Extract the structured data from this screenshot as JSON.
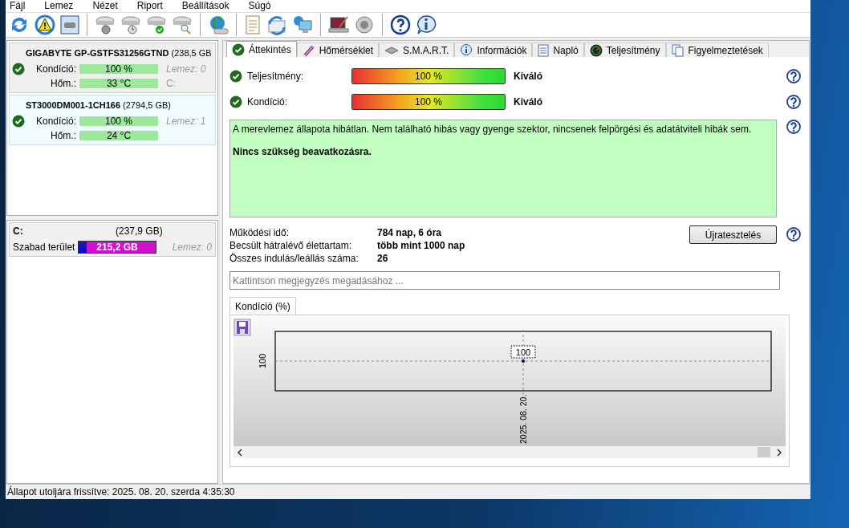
{
  "menu": [
    "Fájl",
    "Lemez",
    "Nézet",
    "Riport",
    "Beállítások",
    "Súgó"
  ],
  "disks": [
    {
      "name": "GIGABYTE GP-GSTFS31256GTND",
      "size": "(238,5 GB",
      "selected": false,
      "healthy": true,
      "rows": [
        {
          "label": "Kondíció:",
          "reading": "100 %",
          "level": 1,
          "note": "Lemez: 0"
        },
        {
          "label": "Hőm.:",
          "reading": "33 °C",
          "level": 1,
          "note": "C:"
        }
      ]
    },
    {
      "name": "ST3000DM001-1CH166",
      "size": "(2794,5 GB)",
      "selected": true,
      "healthy": true,
      "rows": [
        {
          "label": "Kondíció:",
          "reading": "100 %",
          "level": 1,
          "note": "Lemez: 1"
        },
        {
          "label": "Hőm.:",
          "reading": "24 °C",
          "level": 1
        }
      ]
    }
  ],
  "partition": {
    "name": "C:",
    "size": "(237,9 GB)",
    "label": "Szabad terület",
    "reading": "215,2 GB",
    "level": 0.1,
    "note": "Lemez: 0"
  },
  "tabs": [
    {
      "label": "Áttekintés",
      "selected": true
    },
    {
      "label": "Hőmérséklet",
      "selected": false
    },
    {
      "label": "S.M.A.R.T.",
      "selected": false
    },
    {
      "label": "Információk",
      "selected": false
    },
    {
      "label": "Napló",
      "selected": false
    },
    {
      "label": "Teljesítmény",
      "selected": false
    },
    {
      "label": "Figyelmeztetések",
      "selected": false
    }
  ],
  "meters": [
    {
      "label": "Teljesítmény:",
      "healthy": true,
      "level": 1,
      "reading": "100 %",
      "rating": "Kiváló"
    },
    {
      "label": "Kondíció:",
      "healthy": true,
      "level": 1,
      "reading": "100 %",
      "rating": "Kiváló"
    }
  ],
  "message": {
    "text": "A merevlemez állapota hibátlan. Nem található hibás vagy gyenge szektor, nincsenek felpörgési és adatátviteli hibák sem.",
    "advice": "Nincs szükség beavatkozásra."
  },
  "info": [
    {
      "label": "Működési idő:",
      "value": "784 nap, 6 óra"
    },
    {
      "label": "Becsült hátralévő élettartam:",
      "value": "több mint 1000 nap"
    },
    {
      "label": "Összes indulás/leállás száma:",
      "value": "26"
    }
  ],
  "retest_button": "Újratesztelés",
  "note_field": {
    "placeholder": "Kattintson megjegyzés megadásához ..."
  },
  "chart_tab": {
    "label": "Kondíció  (%)",
    "selected": true
  },
  "chart": {
    "y_tick": "100",
    "x_label": "2025. 08. 20.",
    "point_label": "100"
  },
  "status_bar": "Állapot utoljára frissítve: 2025. 08. 20. szerda 4:35:30"
}
